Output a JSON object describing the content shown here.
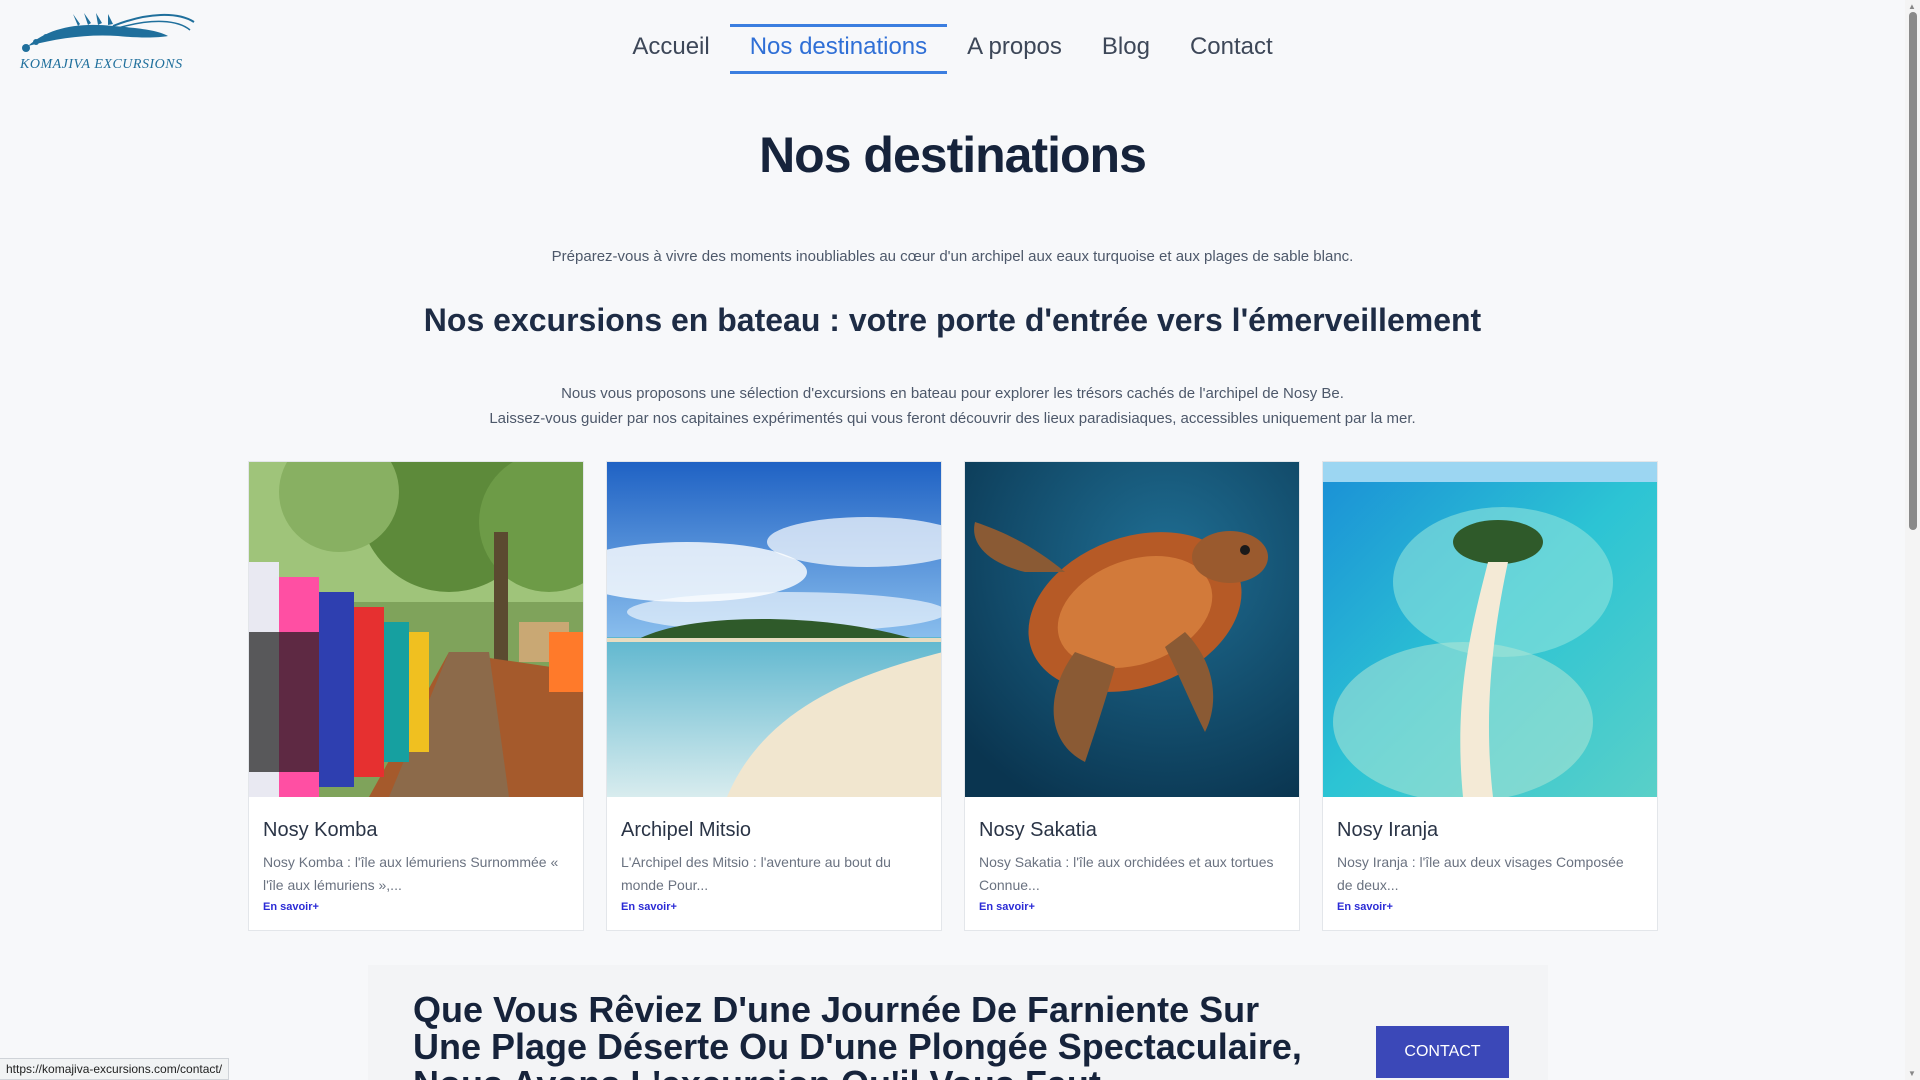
{
  "logo": {
    "text": "KOMAJIVA EXCURSIONS",
    "icon": "shrimp-logo-icon",
    "color": "#1f6f9c"
  },
  "nav": {
    "items": [
      {
        "label": "Accueil",
        "active": false
      },
      {
        "label": "Nos destinations",
        "active": true
      },
      {
        "label": "A propos",
        "active": false
      },
      {
        "label": "Blog",
        "active": false
      },
      {
        "label": "Contact",
        "active": false
      }
    ],
    "accent": "#2f6fd6"
  },
  "page": {
    "title": "Nos destinations",
    "lead": "Préparez-vous à vivre des moments inoubliables au cœur d'un archipel aux eaux turquoise et aux plages de sable blanc.",
    "subtitle": "Nos excursions en bateau : votre porte d'entrée vers l'émerveillement",
    "para_line1": "Nous vous proposons une sélection d'excursions en bateau pour explorer les trésors cachés de l'archipel de Nosy Be.",
    "para_line2": "Laissez-vous guider par nos capitaines expérimentés qui vous feront découvrir des lieux paradisiaques, accessibles uniquement par la mer."
  },
  "cards": [
    {
      "title": "Nosy Komba",
      "text": "Nosy Komba : l'île aux lémuriens Surnommée « l'île aux lémuriens »,...",
      "link": "En savoir+",
      "image": "market-path-image"
    },
    {
      "title": "Archipel Mitsio",
      "text": "L'Archipel des Mitsio : l'aventure au bout du monde Pour...",
      "link": "En savoir+",
      "image": "island-beach-image"
    },
    {
      "title": "Nosy Sakatia",
      "text": "Nosy Sakatia : l'île aux orchidées et aux tortues Connue...",
      "link": "En savoir+",
      "image": "sea-turtle-image"
    },
    {
      "title": "Nosy Iranja",
      "text": "Nosy Iranja : l'île aux deux visages Composée de deux...",
      "link": "En savoir+",
      "image": "sandbank-aerial-image"
    }
  ],
  "banner": {
    "text": "Que Vous Rêviez D'une Journée De Farniente Sur Une Plage Déserte Ou D'une Plongée Spectaculaire, Nous Avons L'excursion Qu'il Vous Faut",
    "button": "CONTACT",
    "button_color": "#3b48b8"
  },
  "status_url": "https://komajiva-excursions.com/contact/"
}
